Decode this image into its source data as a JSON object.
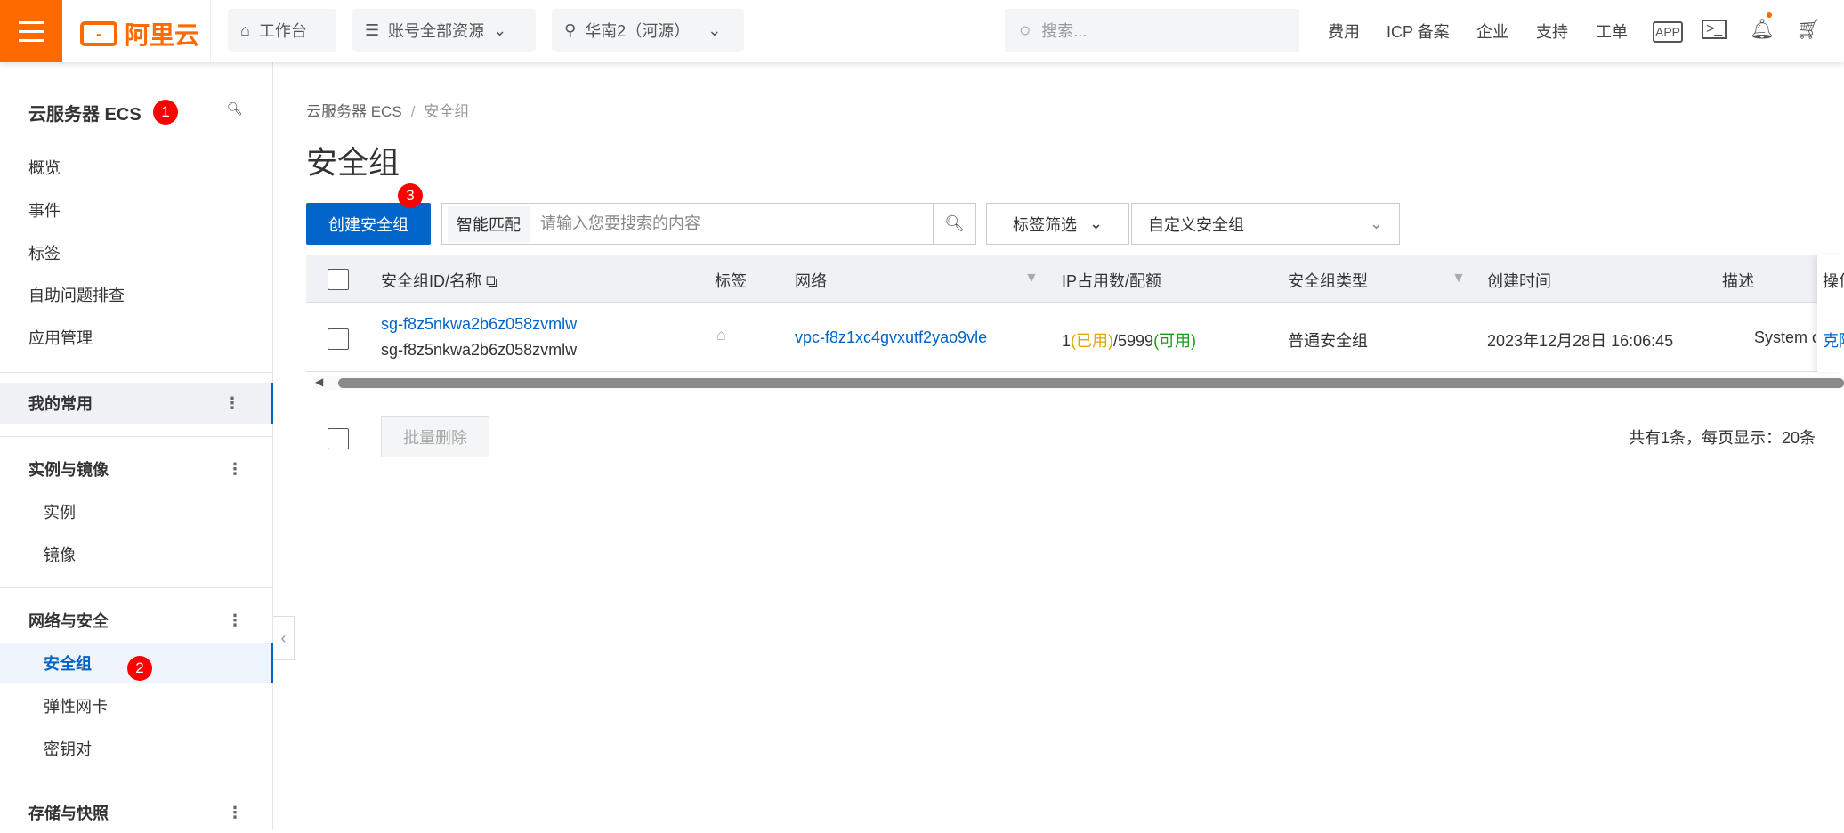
{
  "topbar": {
    "logo": "阿里云",
    "workbench": "工作台",
    "resources": "账号全部资源",
    "region": "华南2（河源）",
    "search_placeholder": "搜索...",
    "links": [
      "费用",
      "ICP 备案",
      "企业",
      "支持",
      "工单"
    ],
    "icons": [
      "app-icon",
      "terminal-icon",
      "bell-icon",
      "cart-icon"
    ],
    "accent": "#ff6a00"
  },
  "sidebar": {
    "title": "云服务器 ECS",
    "items": [
      "概览",
      "事件",
      "标签",
      "自助问题排查",
      "应用管理"
    ],
    "favorites": "我的常用",
    "groups": [
      {
        "label": "实例与镜像",
        "items": [
          "实例",
          "镜像"
        ]
      },
      {
        "label": "网络与安全",
        "items": [
          "安全组",
          "弹性网卡",
          "密钥对"
        ]
      },
      {
        "label": "存储与快照",
        "items": []
      }
    ],
    "active": "安全组"
  },
  "badges": [
    "1",
    "2",
    "3"
  ],
  "main": {
    "breadcrumb": [
      "云服务器 ECS",
      "安全组"
    ],
    "title": "安全组",
    "create_button": "创建安全组",
    "smart_match": "智能匹配",
    "search_placeholder": "请输入您要搜索的内容",
    "tag_filter": "标签筛选",
    "custom_select": "自定义安全组",
    "columns": [
      "安全组ID/名称",
      "标签",
      "网络",
      "IP占用数/配额",
      "安全组类型",
      "创建时间",
      "描述",
      "操作"
    ],
    "rows": [
      {
        "id": "sg-f8z5nkwa2b6z058zvmlw",
        "name": "sg-f8z5nkwa2b6z058zvmlw",
        "network": "vpc-f8z1xc4gvxutf2yao9vle",
        "ip_used": "1",
        "used_label": "(已用)",
        "quota": "/5999",
        "avail_label": "(可用)",
        "type": "普通安全组",
        "created": "2023年12月28日 16:06:45",
        "desc": "System created",
        "action": "克隆"
      }
    ],
    "batch_delete": "批量删除",
    "total": "共有1条，每页显示：20条",
    "primary": "#0064c8"
  }
}
